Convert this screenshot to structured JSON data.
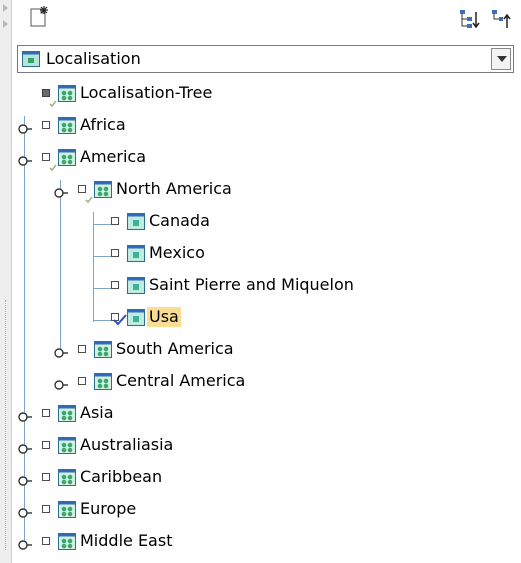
{
  "toolbar": {
    "new_icon": "new-document-icon",
    "tree_icon": "expand-tree-icon",
    "up_icon": "sort-up-icon"
  },
  "selector": {
    "value": "Localisation",
    "icon": "localisation-window-icon"
  },
  "tree": {
    "root": "Localisation-Tree",
    "africa": "Africa",
    "america": "America",
    "north_america": "North America",
    "canada": "Canada",
    "mexico": "Mexico",
    "saint_pierre": "Saint Pierre and Miquelon",
    "usa": "Usa",
    "south_america": "South America",
    "central_america": "Central America",
    "asia": "Asia",
    "australiasia": "Australiasia",
    "caribbean": "Caribbean",
    "europe": "Europe",
    "middle_east": "Middle East",
    "selected_item": "Usa"
  },
  "colors": {
    "selection_highlight": "#f9dd93",
    "tree_line": "#7fa3c9",
    "group_icon": "#3aa86b",
    "leaf_icon": "#35b59a",
    "check_tick": "#2a52c9"
  }
}
